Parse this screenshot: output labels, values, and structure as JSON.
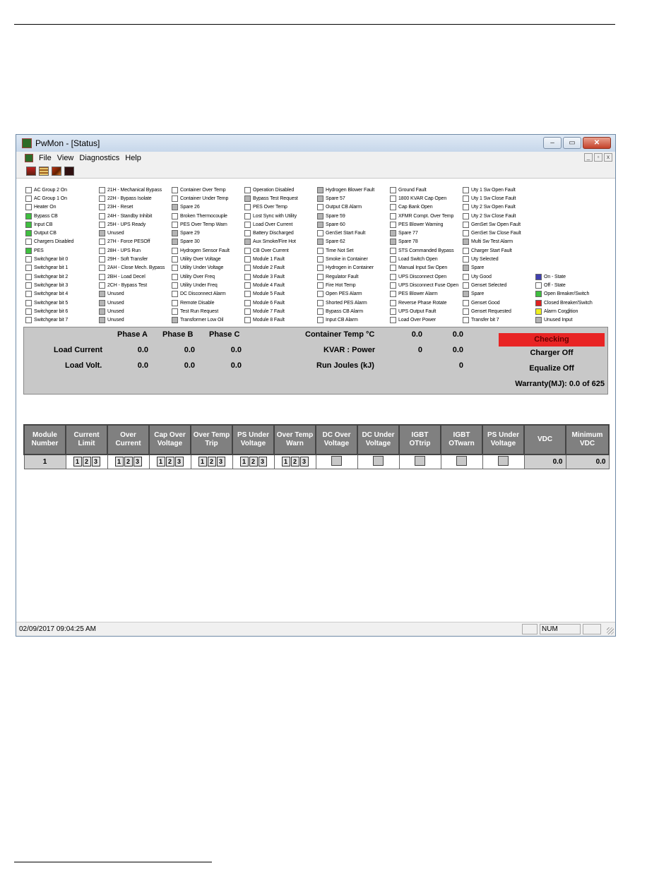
{
  "window": {
    "title": "PwMon - [Status]",
    "buttons": {
      "minimize": "–",
      "maximize": "▭",
      "close": "✕"
    }
  },
  "menu": [
    "File",
    "View",
    "Diagnostics",
    "Help"
  ],
  "mdi_buttons": {
    "minimize": "_",
    "restore": "▫",
    "close": "x"
  },
  "status_columns": [
    [
      {
        "label": "AC Group 2 On",
        "state": "off"
      },
      {
        "label": "AC Group 1 On",
        "state": "off"
      },
      {
        "label": "Heater On",
        "state": "off"
      },
      {
        "label": "Bypass CB",
        "state": "on"
      },
      {
        "label": "Input CB",
        "state": "on"
      },
      {
        "label": "Output CB",
        "state": "on"
      },
      {
        "label": "Chargers Disabled",
        "state": "off"
      },
      {
        "label": "PES",
        "state": "on"
      },
      {
        "label": "Switchgear bit 0",
        "state": "off"
      },
      {
        "label": "Switchgear bit 1",
        "state": "off"
      },
      {
        "label": "Switchgear bit 2",
        "state": "off"
      },
      {
        "label": "Switchgear bit 3",
        "state": "off"
      },
      {
        "label": "Switchgear bit 4",
        "state": "off"
      },
      {
        "label": "Switchgear bit 5",
        "state": "off"
      },
      {
        "label": "Switchgear bit 6",
        "state": "off"
      },
      {
        "label": "Switchgear bit 7",
        "state": "off"
      }
    ],
    [
      {
        "label": "21H - Mechanical Bypass",
        "state": "off"
      },
      {
        "label": "22H - Bypass Isolate",
        "state": "off"
      },
      {
        "label": "23H - Reset",
        "state": "off"
      },
      {
        "label": "24H - Standby Inhibit",
        "state": "off"
      },
      {
        "label": "25H - UPS Ready",
        "state": "off"
      },
      {
        "label": "Unused",
        "state": "unused"
      },
      {
        "label": "27H - Force PESOff",
        "state": "off"
      },
      {
        "label": "28H - UPS Run",
        "state": "off"
      },
      {
        "label": "29H - Soft Transfer",
        "state": "off"
      },
      {
        "label": "2AH - Close Mech. Bypass",
        "state": "off"
      },
      {
        "label": "2BH - Load Decel",
        "state": "off"
      },
      {
        "label": "2CH - Bypass Test",
        "state": "off"
      },
      {
        "label": "Unused",
        "state": "unused"
      },
      {
        "label": "Unused",
        "state": "unused"
      },
      {
        "label": "Unused",
        "state": "unused"
      },
      {
        "label": "Unused",
        "state": "unused"
      }
    ],
    [
      {
        "label": "Container Over Temp",
        "state": "off"
      },
      {
        "label": "Container Under Temp",
        "state": "off"
      },
      {
        "label": "Spare 26",
        "state": "unused"
      },
      {
        "label": "Broken Thermocouple",
        "state": "off"
      },
      {
        "label": "PES Over Temp Warn",
        "state": "off"
      },
      {
        "label": "Spare 29",
        "state": "unused"
      },
      {
        "label": "Spare 30",
        "state": "unused"
      },
      {
        "label": "Hydrogen Sensor Fault",
        "state": "off"
      },
      {
        "label": "Utility Over Voltage",
        "state": "off"
      },
      {
        "label": "Utility Under Voltage",
        "state": "off"
      },
      {
        "label": "Utility Over Freq",
        "state": "off"
      },
      {
        "label": "Utility Under Freq",
        "state": "off"
      },
      {
        "label": "DC Disconnect Alarm",
        "state": "off"
      },
      {
        "label": "Remote Disable",
        "state": "off"
      },
      {
        "label": "Test Run Request",
        "state": "off"
      },
      {
        "label": "Transformer Low Oil",
        "state": "unused"
      }
    ],
    [
      {
        "label": "Operation Disabled",
        "state": "off"
      },
      {
        "label": "Bypass Test Request",
        "state": "unused"
      },
      {
        "label": "PES Over Temp",
        "state": "off"
      },
      {
        "label": "Lost Sync with Utility",
        "state": "off"
      },
      {
        "label": "Load Over Current",
        "state": "off"
      },
      {
        "label": "Battery Discharged",
        "state": "off"
      },
      {
        "label": "Aux Smoke/Fire Hot",
        "state": "unused"
      },
      {
        "label": "CB Over Current",
        "state": "off"
      },
      {
        "label": "Module 1 Fault",
        "state": "off"
      },
      {
        "label": "Module 2 Fault",
        "state": "off"
      },
      {
        "label": "Module 3 Fault",
        "state": "off"
      },
      {
        "label": "Module 4 Fault",
        "state": "off"
      },
      {
        "label": "Module 5 Fault",
        "state": "off"
      },
      {
        "label": "Module 6 Fault",
        "state": "off"
      },
      {
        "label": "Module 7 Fault",
        "state": "off"
      },
      {
        "label": "Module 8 Fault",
        "state": "off"
      }
    ],
    [
      {
        "label": "Hydrogen Blower Fault",
        "state": "unused"
      },
      {
        "label": "Spare 57",
        "state": "unused"
      },
      {
        "label": "Output CB Alarm",
        "state": "off"
      },
      {
        "label": "Spare 59",
        "state": "unused"
      },
      {
        "label": "Spare 60",
        "state": "unused"
      },
      {
        "label": "GenSet Start Fault",
        "state": "off"
      },
      {
        "label": "Spare 62",
        "state": "unused"
      },
      {
        "label": "Time Not Set",
        "state": "off"
      },
      {
        "label": "Smoke in Container",
        "state": "off"
      },
      {
        "label": "Hydrogen in Container",
        "state": "off"
      },
      {
        "label": "Regulator Fault",
        "state": "off"
      },
      {
        "label": "Fire Hot Temp",
        "state": "off"
      },
      {
        "label": "Open PES Alarm",
        "state": "off"
      },
      {
        "label": "Shorted PES Alarm",
        "state": "off"
      },
      {
        "label": "Bypass CB Alarm",
        "state": "off"
      },
      {
        "label": "Input CB Alarm",
        "state": "off"
      }
    ],
    [
      {
        "label": "Ground Fault",
        "state": "off"
      },
      {
        "label": "1800 KVAR Cap Open",
        "state": "off"
      },
      {
        "label": "Cap Bank Open",
        "state": "off"
      },
      {
        "label": "XFMR Compt. Over Temp",
        "state": "off"
      },
      {
        "label": "PES Blower Warning",
        "state": "off"
      },
      {
        "label": "Spare 77",
        "state": "unused"
      },
      {
        "label": "Spare 78",
        "state": "unused"
      },
      {
        "label": "STS Commanded Bypass",
        "state": "off"
      },
      {
        "label": "Load Switch Open",
        "state": "off"
      },
      {
        "label": "Manual Input Sw Open",
        "state": "off"
      },
      {
        "label": "UPS Disconnect Open",
        "state": "off"
      },
      {
        "label": "UPS Disconnect Fuse Open",
        "state": "off"
      },
      {
        "label": "PES Blower Alarm",
        "state": "off"
      },
      {
        "label": "Reverse Phase Rotate",
        "state": "off"
      },
      {
        "label": "UPS Output Fault",
        "state": "off"
      },
      {
        "label": "Load Over Power",
        "state": "off"
      }
    ],
    [
      {
        "label": "Uty 1 Sw Open Fault",
        "state": "off"
      },
      {
        "label": "Uty 1 Sw Close Fault",
        "state": "off"
      },
      {
        "label": "Uty 2 Sw Open Fault",
        "state": "off"
      },
      {
        "label": "Uty 2 Sw Close Fault",
        "state": "off"
      },
      {
        "label": "GenSet Sw Open Fault",
        "state": "off"
      },
      {
        "label": "GenSet Sw Close Fault",
        "state": "off"
      },
      {
        "label": "Multi Sw Test Alarm",
        "state": "unused"
      },
      {
        "label": "Charger Start Fault",
        "state": "off"
      },
      {
        "label": "Uty Selected",
        "state": "off"
      },
      {
        "label": "Spare",
        "state": "unused"
      },
      {
        "label": "Uty Good",
        "state": "off"
      },
      {
        "label": "Genset Selected",
        "state": "off"
      },
      {
        "label": "Spare",
        "state": "unused"
      },
      {
        "label": "Genset Good",
        "state": "off"
      },
      {
        "label": "Genset Requested",
        "state": "off"
      },
      {
        "label": "Transfer bit 7",
        "state": "off"
      }
    ]
  ],
  "legend": [
    {
      "label": "On - State",
      "color": "#4040b0"
    },
    {
      "label": "Off - State",
      "color": "#ffffff"
    },
    {
      "label": "Open Breaker/Switch",
      "color": "#3fbf3f"
    },
    {
      "label": "Closed Breaker/Switch",
      "color": "#e02020"
    },
    {
      "label": "Alarm Condition",
      "color": "#f0f020"
    },
    {
      "label": "Unused Input",
      "color": "#b4b4b4"
    }
  ],
  "legend_dash": "--",
  "panel": {
    "phase_a": "Phase A",
    "phase_b": "Phase B",
    "phase_c": "Phase C",
    "load_current_label": "Load Current",
    "load_current": [
      "0.0",
      "0.0",
      "0.0"
    ],
    "load_volt_label": "Load Volt.",
    "load_volt": [
      "0.0",
      "0.0",
      "0.0"
    ],
    "container_temp_label": "Container Temp °C",
    "container_temp": [
      "0.0",
      "0.0"
    ],
    "kvar_label": "KVAR : Power",
    "kvar": [
      "0",
      "0.0"
    ],
    "run_joules_label": "Run Joules (kJ)",
    "run_joules": "0",
    "checking": "Checking",
    "charger": "Charger Off",
    "equalize": "Equalize Off",
    "warranty": "Warranty(MJ): 0.0 of 625"
  },
  "module_table": {
    "headers": [
      "Module Number",
      "Current Limit",
      "Over Current",
      "Cap Over Voltage",
      "Over Temp Trip",
      "PS Under Voltage",
      "Over Temp Warn",
      "DC Over Voltage",
      "DC Under Voltage",
      "IGBT OTtrip",
      "IGBT OTwarn",
      "PS Under Voltage",
      "VDC",
      "Minimum VDC"
    ],
    "rows": [
      {
        "module": "1",
        "triples": [
          [
            "1",
            "2",
            "3"
          ],
          [
            "1",
            "2",
            "3"
          ],
          [
            "1",
            "2",
            "3"
          ],
          [
            "1",
            "2",
            "3"
          ],
          [
            "1",
            "2",
            "3"
          ],
          [
            "1",
            "2",
            "3"
          ]
        ],
        "vdc": "0.0",
        "min_vdc": "0.0"
      }
    ]
  },
  "status_bar": {
    "datetime": "02/09/2017 09:04:25 AM",
    "num": "NUM"
  }
}
